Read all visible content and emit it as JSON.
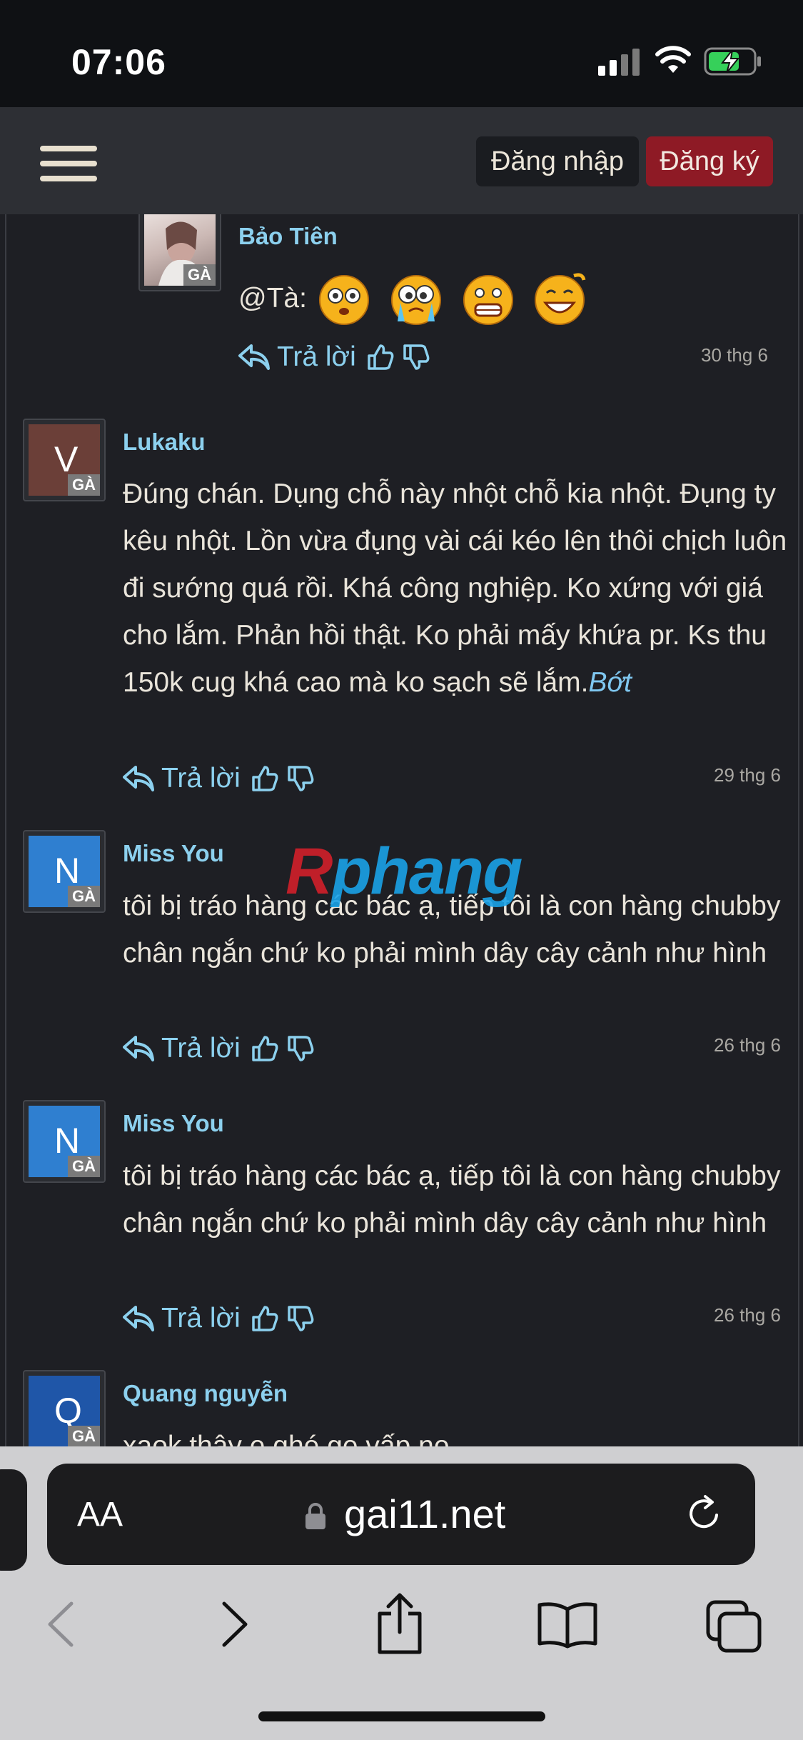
{
  "status_bar": {
    "time": "07:06"
  },
  "nav": {
    "login_label": "Đăng nhập",
    "register_label": "Đăng ký"
  },
  "comments": [
    {
      "avatar_tag": "GÀ",
      "username": "Bảo Tiên",
      "text": "@Tà:",
      "reply_label": "Trả lời",
      "date": "30 thg 6"
    },
    {
      "avatar_letter": "V",
      "avatar_tag": "GÀ",
      "avatar_color": "#6b3f38",
      "username": "Lukaku",
      "text": "Đúng chán. Dụng chỗ này nhột chỗ kia nhột. Đụng ty kêu nhột. Lồn vừa đụng vài cái kéo lên thôi chịch luôn đi sướng quá rồi. Khá công nghiệp. Ko xứng với giá cho lắm. Phản hồi thật. Ko phải mấy khứa pr. Ks thu 150k cug khá cao mà ko sạch sẽ lắm.",
      "more_label": "Bớt",
      "reply_label": "Trả lời",
      "date": "29 thg 6"
    },
    {
      "avatar_letter": "N",
      "avatar_tag": "GÀ",
      "avatar_color": "#2f7fd0",
      "username": "Miss You",
      "text": "tôi bị tráo hàng các bác ạ, tiếp tôi là con hàng chubby chân ngắn chứ ko phải mình dây cây cảnh như hình",
      "reply_label": "Trả lời",
      "date": "26 thg 6"
    },
    {
      "avatar_letter": "N",
      "avatar_tag": "GÀ",
      "avatar_color": "#2f7fd0",
      "username": "Miss You",
      "text": "tôi bị tráo hàng các bác ạ, tiếp tôi là con hàng chubby chân ngắn chứ ko phải mình dây cây cảnh như hình",
      "reply_label": "Trả lời",
      "date": "26 thg 6"
    },
    {
      "avatar_letter": "Q",
      "avatar_tag": "GÀ",
      "avatar_color": "#1f56a8",
      "username": "Quang nguyễn",
      "text": "xaok thây e ghé ge vấp nọ"
    }
  ],
  "watermark": {
    "prefix": "R",
    "rest": "phang"
  },
  "browser": {
    "text_size_label": "AA",
    "url": "gai11.net"
  }
}
